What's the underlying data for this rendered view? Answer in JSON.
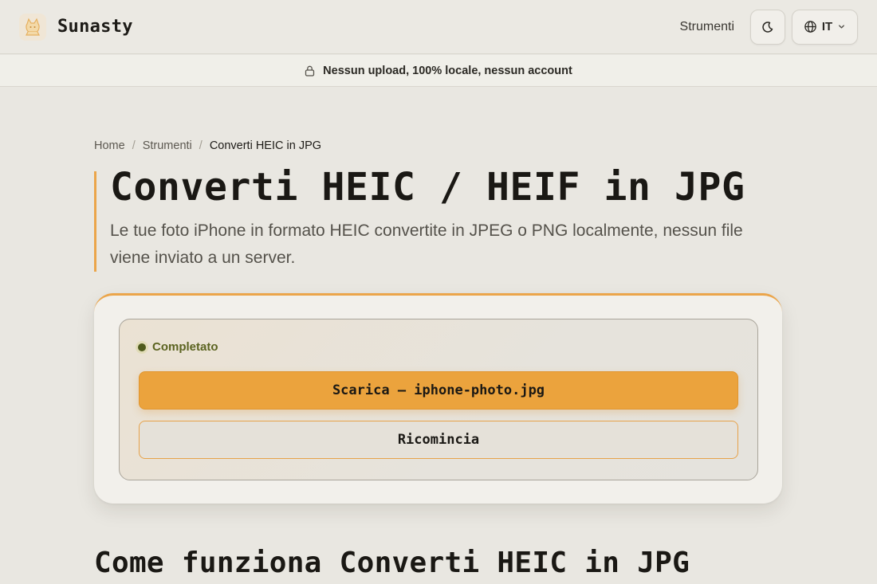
{
  "app": {
    "brand_name": "Sunasty",
    "logo_icon": "cat-icon"
  },
  "header": {
    "nav_tools_label": "Strumenti",
    "theme_icon": "moon-icon",
    "language": {
      "icon": "globe-icon",
      "code": "IT",
      "chevron_icon": "chevron-down-icon"
    }
  },
  "banner": {
    "icon": "lock-icon",
    "text": "Nessun upload, 100% locale, nessun account"
  },
  "breadcrumb": {
    "items": [
      "Home",
      "Strumenti",
      "Converti HEIC in JPG"
    ],
    "separator": "/"
  },
  "page": {
    "title": "Converti HEIC / HEIF in JPG",
    "subtitle": "Le tue foto iPhone in formato HEIC convertite in JPEG o PNG localmente, nessun file viene inviato a un server."
  },
  "converter": {
    "status_label": "Completato",
    "download_label": "Scarica — iphone-photo.jpg",
    "restart_label": "Ricomincia"
  },
  "section": {
    "heading": "Come funziona Converti HEIC in JPG"
  },
  "colors": {
    "accent": "#eba33d",
    "status_ok": "#4f5b1d",
    "background": "#e9e7e1"
  }
}
